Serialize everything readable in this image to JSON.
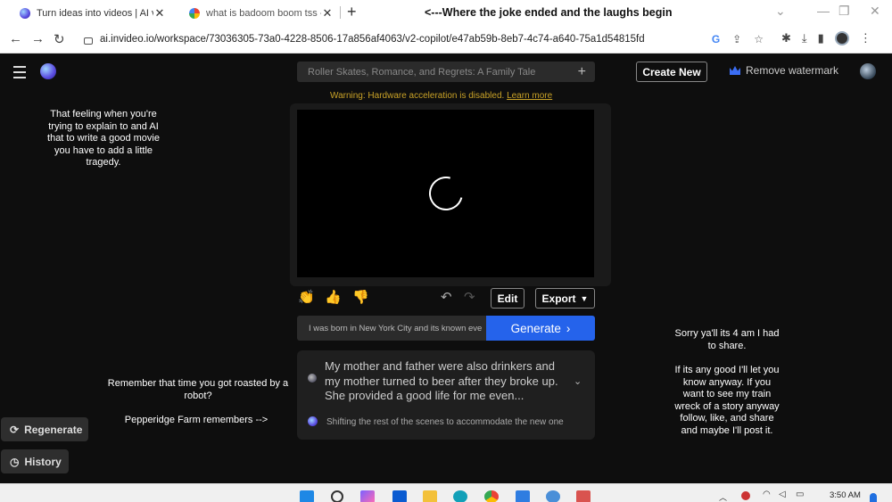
{
  "browser": {
    "tabs": [
      {
        "title": "Turn ideas into videos | AI video",
        "active": true
      },
      {
        "title": "what is badoom boom tss - Goo",
        "active": false
      }
    ],
    "caption_top": "<---Where the joke ended and the laughs begin",
    "url": "ai.invideo.io/workspace/73036305-73a0-4228-8506-17a856af4063/v2-copilot/e47ab59b-8eb7-4c74-a640-75a1d54815fd"
  },
  "app": {
    "topic": "Roller Skates, Romance, and Regrets: A Family Tale",
    "create_new": "Create New",
    "remove_watermark": "Remove watermark",
    "warning_text": "Warning: Hardware acceleration is disabled.",
    "warning_link": "Learn more",
    "edit_label": "Edit",
    "export_label": "Export",
    "prompt_value": "I was born in New York City and its known ever",
    "generate_label": "Generate",
    "scene_message": "My mother and father were also drinkers and my mother turned to beer after they broke up. She provided a good life for me even...",
    "scene_status": "Shifting the rest of the scenes to accommodate the new one",
    "regenerate_label": "Regenerate",
    "history_label": "History",
    "accent_color": "#2563eb",
    "warning_color": "#c9a227"
  },
  "overlays": {
    "left_top": "That feeling when you're trying to explain to and AI that to write a good movie you have to add a little tragedy.",
    "left_mid": "Remember that time you got roasted by a robot?",
    "left_bottom": "Pepperidge Farm remembers -->",
    "right_para1": "Sorry ya'll its 4 am I had to share.",
    "right_para2": "If its any good I'll let you know anyway. If you want to see my train wreck of a story anyway follow, like, and share and maybe I'll post it."
  },
  "taskbar": {
    "time": "3:50 AM"
  }
}
